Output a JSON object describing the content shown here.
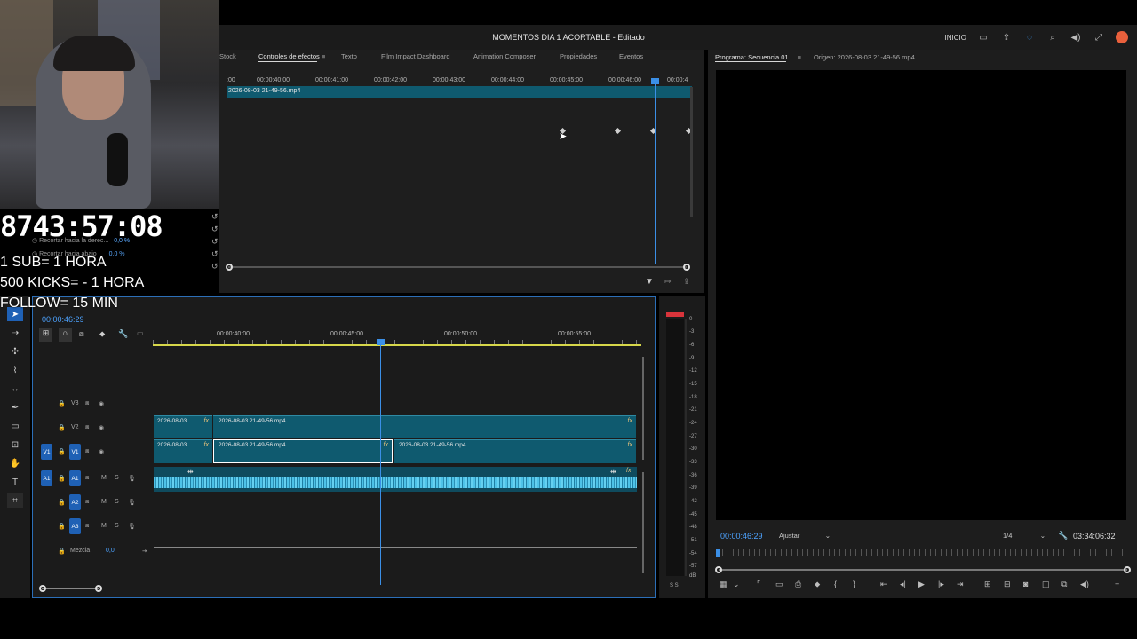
{
  "app": {
    "title": "MOMENTOS DIA 1 ACORTABLE - Editado",
    "home_label": "INICIO"
  },
  "effects_panel": {
    "tabs": [
      "Stock",
      "Controles de efectos",
      "Texto",
      "Film Impact Dashboard",
      "Animation Composer",
      "Propiedades",
      "Eventos"
    ],
    "active_tab": "Controles de efectos",
    "ruler_ticks": [
      ":00",
      "00:00:40:00",
      "00:00:41:00",
      "00:00:42:00",
      "00:00:43:00",
      "00:00:44:00",
      "00:00:45:00",
      "00:00:46:00",
      "00:00:4"
    ],
    "clip_name": "2026-08-03 21-49-56.mp4",
    "param_rows": [
      {
        "label": "Recortar hacia la derec...",
        "value": "0,0 %"
      },
      {
        "label": "Recortar hacia abajo",
        "value": "0,0 %"
      }
    ],
    "timecode": "00:00:46:29"
  },
  "program_monitor": {
    "tab_program": "Programa: Secuencia 01",
    "tab_source": "Origen: 2026-08-03 21-49-56.mp4",
    "timecode": "00:00:46:29",
    "fit": "Ajustar",
    "resolution": "1/4",
    "duration": "03:34:06:32"
  },
  "timeline": {
    "ruler": [
      "00:00:40:00",
      "00:00:45:00",
      "00:00:50:00",
      "00:00:55:00"
    ],
    "tracks": [
      {
        "id": "V3",
        "label": "V3"
      },
      {
        "id": "V2",
        "label": "V2"
      },
      {
        "id": "V1",
        "label": "V1",
        "source": "V1"
      },
      {
        "id": "A1",
        "label": "A1",
        "source": "A1",
        "m": "M",
        "s": "S"
      },
      {
        "id": "A2",
        "label": "A2",
        "m": "M",
        "s": "S"
      },
      {
        "id": "A3",
        "label": "A3",
        "m": "M",
        "s": "S"
      }
    ],
    "mix_label": "Mezcla",
    "mix_value": "0,0",
    "clips": {
      "v2_a": "2026-08-03...",
      "v2_b": "2026-08-03 21-49-56.mp4",
      "v1_a": "2026-08-03...",
      "v1_b": "2026-08-03 21-49-56.mp4",
      "v1_c": "2026-08-03 21-49-56.mp4"
    },
    "fx_label": "fx"
  },
  "audio_meter": {
    "labels": [
      "0",
      "-3",
      "-6",
      "-9",
      "-12",
      "-15",
      "-18",
      "-21",
      "-24",
      "-27",
      "-30",
      "-33",
      "-36",
      "-39",
      "-42",
      "-45",
      "-48",
      "-51",
      "-54",
      "-57",
      "dB"
    ],
    "bottom": "S S"
  },
  "stream_overlay": {
    "countdown": "8743:57:08",
    "rule_1": "1 SUB= 1 HORA",
    "rule_2": "500 KICKS= - 1 HORA",
    "rule_3": "FOLLOW= 15 MIN"
  },
  "colors": {
    "accent": "#2d8ceb",
    "clip": "#0f5a6f",
    "audio": "#4fc3e8",
    "panel": "#1d1d1d"
  }
}
